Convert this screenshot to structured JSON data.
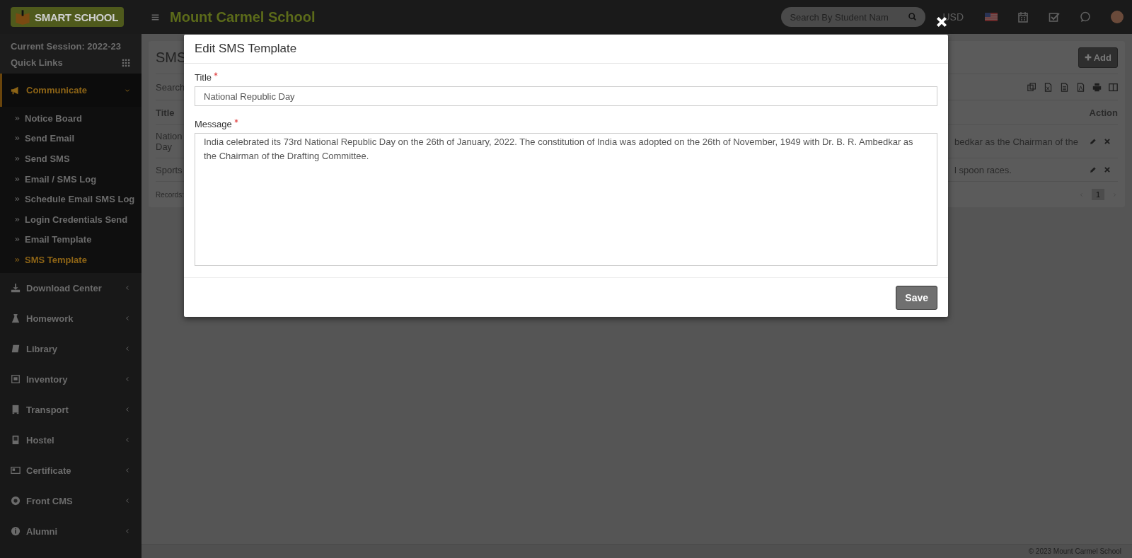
{
  "topbar": {
    "logo": "SMART SCHOOL",
    "school_name": "Mount Carmel School",
    "search": {
      "placeholder": "Search By Student Nam"
    },
    "currency": "USD"
  },
  "sidebar": {
    "session": "Current Session: 2022-23",
    "quick_links": "Quick Links",
    "menu": [
      {
        "label": "Communicate",
        "expanded": true,
        "children": [
          {
            "label": "Notice Board",
            "selected": false
          },
          {
            "label": "Send Email",
            "selected": false
          },
          {
            "label": "Send SMS",
            "selected": false
          },
          {
            "label": "Email / SMS Log",
            "selected": false
          },
          {
            "label": "Schedule Email SMS Log",
            "selected": false
          },
          {
            "label": "Login Credentials Send",
            "selected": false
          },
          {
            "label": "Email Template",
            "selected": false
          },
          {
            "label": "SMS Template",
            "selected": true
          }
        ]
      },
      {
        "label": "Download Center",
        "expanded": false
      },
      {
        "label": "Homework",
        "expanded": false
      },
      {
        "label": "Library",
        "expanded": false
      },
      {
        "label": "Inventory",
        "expanded": false
      },
      {
        "label": "Transport",
        "expanded": false
      },
      {
        "label": "Hostel",
        "expanded": false
      },
      {
        "label": "Certificate",
        "expanded": false
      },
      {
        "label": "Front CMS",
        "expanded": false
      },
      {
        "label": "Alumni",
        "expanded": false
      }
    ]
  },
  "panel": {
    "title": "SMS",
    "add_button": "Add",
    "search": "Search",
    "columns": [
      "Title",
      "Action"
    ],
    "rows": [
      {
        "title": "Nation Day",
        "message": "bedkar as the Chairman of the"
      },
      {
        "title": "Sports",
        "message": "l spoon races."
      }
    ],
    "records": "Records:",
    "page": "1"
  },
  "modal": {
    "title": "Edit SMS Template",
    "fields": [
      {
        "kind": "input",
        "label": "Title",
        "required": true,
        "value": "National Republic Day"
      },
      {
        "kind": "textarea",
        "label": "Message",
        "required": true,
        "value": "India celebrated its 73rd National Republic Day on the 26th of January, 2022. The constitution of India was adopted on the 26th of November, 1949 with Dr. B. R. Ambedkar as the Chairman of the Drafting Committee."
      }
    ],
    "save_button": "Save"
  },
  "footer": "© 2023 Mount Carmel School"
}
